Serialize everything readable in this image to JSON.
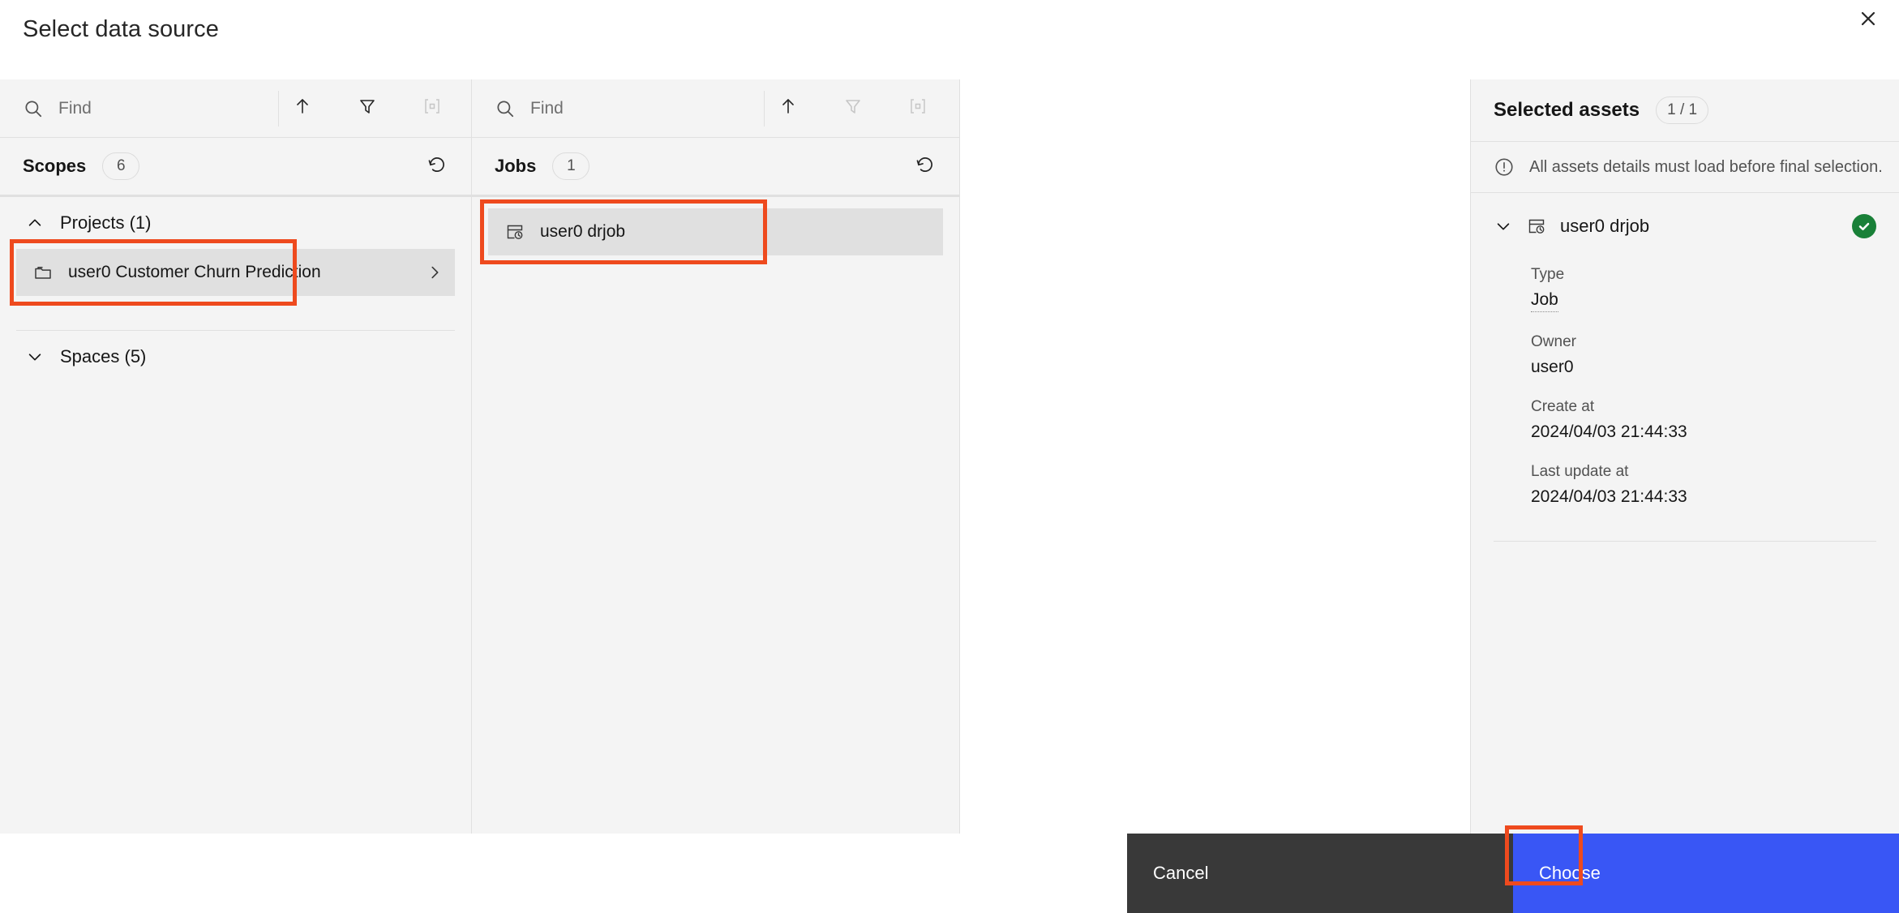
{
  "dialog": {
    "title": "Select data source",
    "close_icon": "close-icon"
  },
  "scopes_panel": {
    "search": {
      "placeholder": "Find",
      "value": ""
    },
    "tools": [
      {
        "name": "sort-ascending-icon",
        "label": "Sort"
      },
      {
        "name": "filter-icon",
        "label": "Filter"
      },
      {
        "name": "fit-to-screen-icon",
        "label": "Fit to screen"
      }
    ],
    "header": {
      "title": "Scopes",
      "count": "6",
      "refresh_icon": "refresh-icon"
    },
    "groups": [
      {
        "label": "Projects (1)",
        "expanded": true,
        "items": [
          {
            "label": "user0 Customer Churn Prediction",
            "icon": "folder-icon",
            "selected": true,
            "has_chevron": true
          }
        ]
      },
      {
        "label": "Spaces (5)",
        "expanded": false,
        "items": []
      }
    ]
  },
  "jobs_panel": {
    "search": {
      "placeholder": "Find",
      "value": ""
    },
    "tools": [
      {
        "name": "sort-ascending-icon",
        "label": "Sort"
      },
      {
        "name": "filter-icon",
        "label": "Filter"
      },
      {
        "name": "fit-to-screen-icon",
        "label": "Fit to screen"
      }
    ],
    "header": {
      "title": "Jobs",
      "count": "1",
      "refresh_icon": "refresh-icon"
    },
    "items": [
      {
        "label": "user0 drjob",
        "icon": "job-icon",
        "selected": true
      }
    ]
  },
  "selected_panel": {
    "title": "Selected assets",
    "count": "1 / 1",
    "notice": {
      "icon": "warning-circle-icon",
      "text": "All assets details must load before final selection."
    },
    "asset": {
      "name": "user0 drjob",
      "icon": "job-icon",
      "status_icon": "check-circle-icon",
      "expanded": true,
      "fields": [
        {
          "label": "Type",
          "value": "Job"
        },
        {
          "label": "Owner",
          "value": "user0"
        },
        {
          "label": "Create at",
          "value": "2024/04/03 21:44:33"
        },
        {
          "label": "Last update at",
          "value": "2024/04/03 21:44:33"
        }
      ]
    }
  },
  "footer": {
    "cancel_label": "Cancel",
    "choose_label": "Choose"
  },
  "colors": {
    "accent": "#3956f5",
    "highlight": "#ee4a1e",
    "success": "#198038",
    "panel_bg": "#f4f4f4",
    "cancel_bg": "#393939"
  }
}
